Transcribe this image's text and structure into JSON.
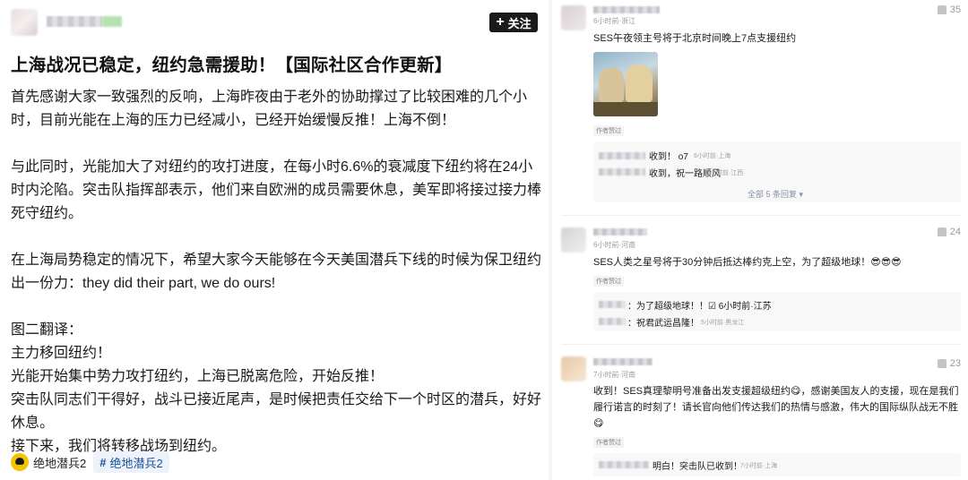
{
  "post": {
    "follow_label": "关注",
    "title": "上海战况已稳定，纽约急需援助！【国际社区合作更新】",
    "paragraphs": [
      "首先感谢大家一致强烈的反响，上海昨夜由于老外的协助撑过了比较困难的几个小时，目前光能在上海的压力已经减小，已经开始缓慢反推！上海不倒！",
      "",
      "与此同时，光能加大了对纽约的攻打进度，在每小时6.6%的衰减度下纽约将在24小时内沦陷。突击队指挥部表示，他们来自欧洲的成员需要休息，美军即将接过接力棒死守纽约。",
      "",
      "在上海局势稳定的情况下，希望大家今天能够在今天美国潜兵下线的时候为保卫纽约出一份力：they did their part, we do ours!",
      "",
      "图二翻译：",
      "主力移回纽约！",
      "光能开始集中势力攻打纽约，上海已脱离危险，开始反推！",
      "突击队同志们干得好，战斗已接近尾声，是时候把责任交给下一个时区的潜兵，好好休息。",
      "接下来，我们将转移战场到纽约。"
    ],
    "tags": {
      "game": "绝地潜兵2",
      "topic": "绝地潜兵2"
    }
  },
  "comments": [
    {
      "meta": "6小时前·浙江",
      "likes": "35",
      "text": "SES午夜领主号将于北京时间晚上7点支援纽约",
      "author_tag": "作者赞过",
      "replies": [
        {
          "text": "收到！ o7",
          "meta": "6小时前·上海"
        },
        {
          "text": "收到，祝一路顺风",
          "meta": "6小时前·江西"
        }
      ],
      "more": "全部 5 条回复 ▾"
    },
    {
      "meta": "6小时前·河南",
      "likes": "24",
      "text": "SES人类之星号将于30分钟后抵达棒约克上空，为了超级地球！😎😎😎",
      "author_tag": "作者赞过",
      "replies": [
        {
          "text": "：为了超级地球！！☑ 6小时前·江苏",
          "meta": ""
        },
        {
          "text": "：祝君武运昌隆！",
          "meta": "5小时前·黑龙江"
        }
      ]
    },
    {
      "meta": "7小时前·河南",
      "likes": "23",
      "text_lines": [
        "收到！SES真理黎明号准备出发支援超级纽约😋，感谢美国友人的支援，现在是我们",
        "履行诺言的时刻了！请长官向他们传达我们的热情与感激，伟大的国际纵队战无不胜",
        "😋"
      ],
      "author_tag": "作者赞过",
      "replies": [
        {
          "text": "明白！突击队已收到！",
          "meta": "7小时前·上海"
        }
      ]
    }
  ],
  "colors": {
    "follow_bg": "#1a1a1a",
    "topic_link": "#175199",
    "topic_bg": "#eef3fb",
    "muted": "#9a9a9a"
  }
}
